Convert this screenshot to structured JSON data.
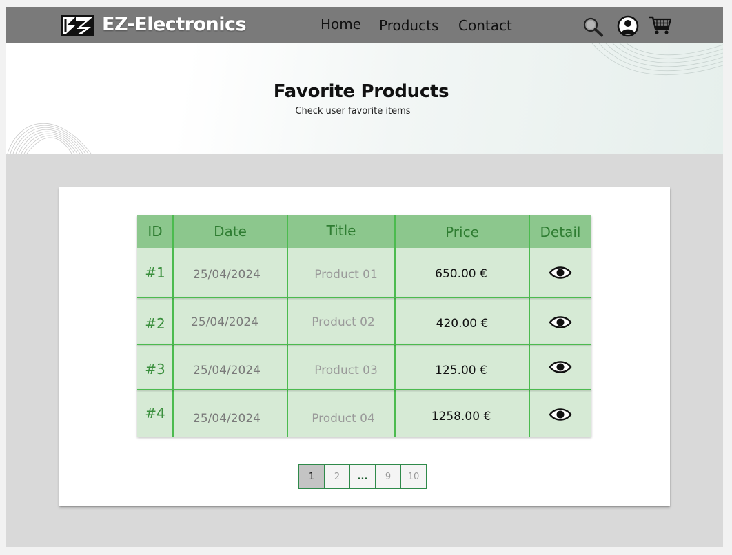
{
  "header": {
    "brand": "EZ-Electronics",
    "nav": [
      "Home",
      "Products",
      "Contact"
    ],
    "icons": [
      "search-icon",
      "account-icon",
      "cart-icon"
    ]
  },
  "hero": {
    "title": "Favorite Products",
    "subtitle": "Check user favorite items"
  },
  "table": {
    "columns": [
      "ID",
      "Date",
      "Title",
      "Price",
      "Detail"
    ],
    "rows": [
      {
        "id": "#1",
        "date": "25/04/2024",
        "title": "Product 01",
        "price": "650.00 €",
        "detail_icon": "eye-icon"
      },
      {
        "id": "#2",
        "date": "25/04/2024",
        "title": "Product 02",
        "price": "420.00 €",
        "detail_icon": "eye-icon"
      },
      {
        "id": "#3",
        "date": "25/04/2024",
        "title": "Product 03",
        "price": "125.00 €",
        "detail_icon": "eye-icon"
      },
      {
        "id": "#4",
        "date": "25/04/2024",
        "title": "Product 04",
        "price": "1258.00 €",
        "detail_icon": "eye-icon"
      }
    ]
  },
  "pagination": {
    "pages": [
      "1",
      "2",
      "...",
      "9",
      "10"
    ],
    "current": "1"
  },
  "colors": {
    "navbar": "#7a7a7a",
    "table_header": "#8cc78d",
    "table_body": "#d6ead5",
    "table_lines": "#4cbb4f",
    "header_text": "#2f7d32"
  }
}
